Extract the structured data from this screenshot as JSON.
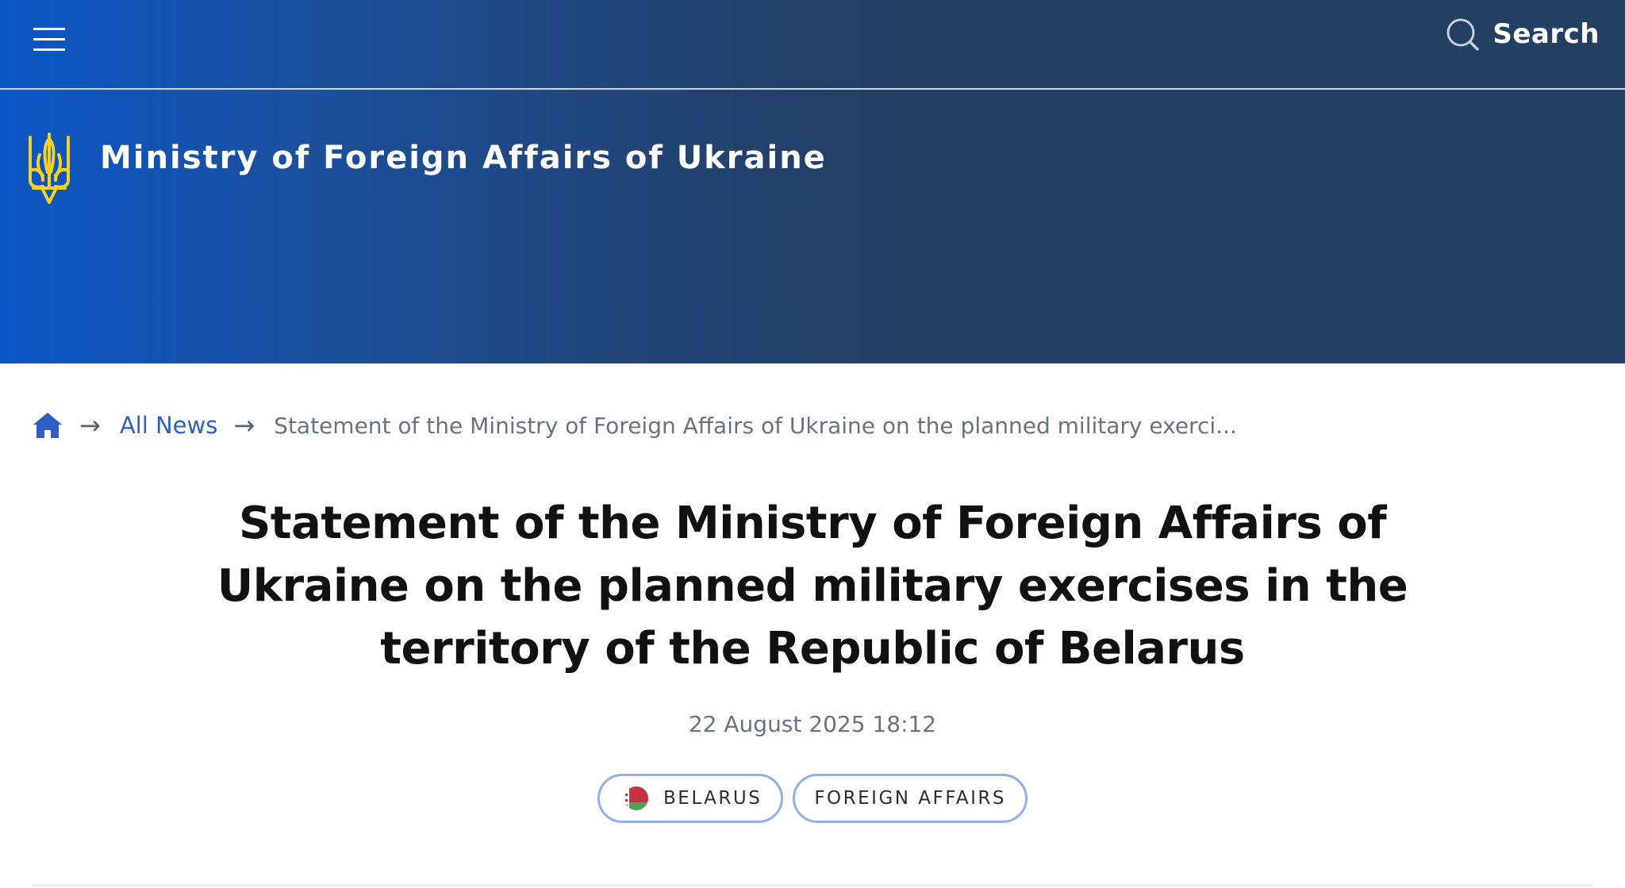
{
  "header": {
    "search_label": "Search",
    "brand_name": "Ministry of Foreign Affairs of Ukraine"
  },
  "breadcrumb": {
    "separator": "→",
    "all_news": "All News",
    "current": "Statement of the Ministry of Foreign Affairs of Ukraine on the planned military exerci..."
  },
  "article": {
    "title": "Statement of the Ministry of Foreign Affairs of Ukraine on the planned military exercises in the territory of the Republic of Belarus",
    "date": "22 August 2025 18:12",
    "tags": [
      {
        "label": "BELARUS",
        "icon": "belarus-flag-icon"
      },
      {
        "label": "FOREIGN AFFAIRS"
      }
    ]
  },
  "colors": {
    "header_gradient_start": "#0b57c7",
    "header_gradient_end": "#233f62",
    "link": "#2d5fc4",
    "tag_border": "#8fb0ea",
    "trident": "#f6d21f"
  }
}
